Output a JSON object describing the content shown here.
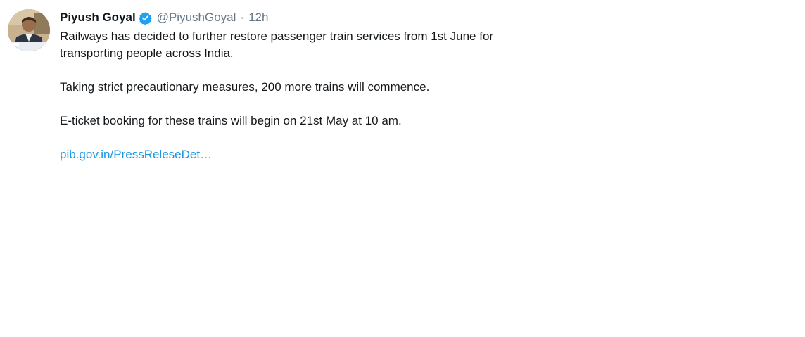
{
  "tweet": {
    "author_name": "Piyush Goyal",
    "handle": "@PiyushGoyal",
    "separator": "·",
    "timestamp": "12h",
    "avatar_icon": "profile-photo",
    "verified_icon": "verified-badge-icon",
    "accent_color": "#1b95e0",
    "paragraphs": [
      "Railways has decided to further restore passenger train services from 1st June for transporting people across India.",
      "Taking strict precautionary measures, 200 more trains will commence.",
      "E-ticket booking for these trains will begin on 21st May at 10 am."
    ],
    "link_text": "pib.gov.in/PressReleseDet…"
  }
}
